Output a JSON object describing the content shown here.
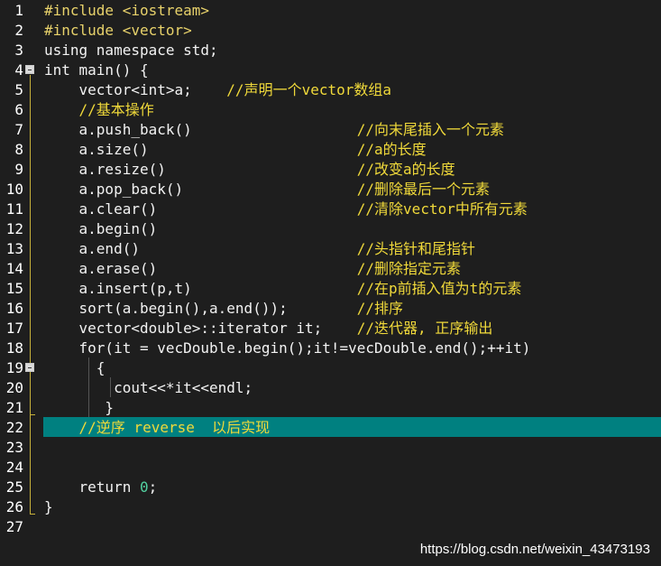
{
  "editor": {
    "line_numbers": [
      "1",
      "2",
      "3",
      "4",
      "5",
      "6",
      "7",
      "8",
      "9",
      "10",
      "11",
      "12",
      "13",
      "14",
      "15",
      "16",
      "17",
      "18",
      "19",
      "20",
      "21",
      "22",
      "23",
      "24",
      "25",
      "26",
      "27"
    ],
    "highlighted_line": "22",
    "lines": [
      {
        "n": "1",
        "segments": [
          {
            "cls": "t-pre",
            "text": "#include <iostream>"
          }
        ]
      },
      {
        "n": "2",
        "segments": [
          {
            "cls": "t-pre",
            "text": "#include <vector>"
          }
        ]
      },
      {
        "n": "3",
        "segments": [
          {
            "cls": "t-plain",
            "text": "using namespace std;"
          }
        ]
      },
      {
        "n": "4",
        "segments": [
          {
            "cls": "t-plain",
            "text": "int main() {"
          }
        ]
      },
      {
        "n": "5",
        "segments": [
          {
            "cls": "t-plain",
            "text": "    vector<int>a;    "
          },
          {
            "cls": "t-com",
            "text": "//声明一个vector数组a"
          }
        ]
      },
      {
        "n": "6",
        "segments": [
          {
            "cls": "t-com",
            "text": "    //基本操作"
          }
        ]
      },
      {
        "n": "7",
        "segments": [
          {
            "cls": "t-plain",
            "text": "    a.push_back()                   "
          },
          {
            "cls": "t-com",
            "text": "//向末尾插入一个元素"
          }
        ]
      },
      {
        "n": "8",
        "segments": [
          {
            "cls": "t-plain",
            "text": "    a.size()                        "
          },
          {
            "cls": "t-com",
            "text": "//a的长度"
          }
        ]
      },
      {
        "n": "9",
        "segments": [
          {
            "cls": "t-plain",
            "text": "    a.resize()                      "
          },
          {
            "cls": "t-com",
            "text": "//改变a的长度"
          }
        ]
      },
      {
        "n": "10",
        "segments": [
          {
            "cls": "t-plain",
            "text": "    a.pop_back()                    "
          },
          {
            "cls": "t-com",
            "text": "//删除最后一个元素"
          }
        ]
      },
      {
        "n": "11",
        "segments": [
          {
            "cls": "t-plain",
            "text": "    a.clear()                       "
          },
          {
            "cls": "t-com",
            "text": "//清除vector中所有元素"
          }
        ]
      },
      {
        "n": "12",
        "segments": [
          {
            "cls": "t-plain",
            "text": "    a.begin()"
          }
        ]
      },
      {
        "n": "13",
        "segments": [
          {
            "cls": "t-plain",
            "text": "    a.end()                         "
          },
          {
            "cls": "t-com",
            "text": "//头指针和尾指针"
          }
        ]
      },
      {
        "n": "14",
        "segments": [
          {
            "cls": "t-plain",
            "text": "    a.erase()                       "
          },
          {
            "cls": "t-com",
            "text": "//删除指定元素"
          }
        ]
      },
      {
        "n": "15",
        "segments": [
          {
            "cls": "t-plain",
            "text": "    a.insert(p,t)                   "
          },
          {
            "cls": "t-com",
            "text": "//在p前插入值为t的元素"
          }
        ]
      },
      {
        "n": "16",
        "segments": [
          {
            "cls": "t-plain",
            "text": "    sort(a.begin(),a.end());        "
          },
          {
            "cls": "t-com",
            "text": "//排序"
          }
        ]
      },
      {
        "n": "17",
        "segments": [
          {
            "cls": "t-plain",
            "text": "    vector<double>::iterator it;    "
          },
          {
            "cls": "t-com",
            "text": "//迭代器, 正序输出"
          }
        ]
      },
      {
        "n": "18",
        "segments": [
          {
            "cls": "t-plain",
            "text": "    for(it = vecDouble.begin();it!=vecDouble.end();++it)"
          }
        ]
      },
      {
        "n": "19",
        "segments": [
          {
            "cls": "t-plain",
            "text": "      {"
          }
        ]
      },
      {
        "n": "20",
        "segments": [
          {
            "cls": "t-plain",
            "text": "        cout<<*it<<endl;"
          }
        ]
      },
      {
        "n": "21",
        "segments": [
          {
            "cls": "t-plain",
            "text": "       }"
          }
        ]
      },
      {
        "n": "22",
        "segments": [
          {
            "cls": "t-com",
            "text": "    //逆序 reverse  以后实现"
          }
        ]
      },
      {
        "n": "23",
        "segments": []
      },
      {
        "n": "24",
        "segments": []
      },
      {
        "n": "25",
        "segments": [
          {
            "cls": "t-plain",
            "text": "    return "
          },
          {
            "cls": "t-num",
            "text": "0"
          },
          {
            "cls": "t-plain",
            "text": ";"
          }
        ]
      },
      {
        "n": "26",
        "segments": [
          {
            "cls": "t-plain",
            "text": "}"
          }
        ]
      },
      {
        "n": "27",
        "segments": []
      }
    ]
  },
  "watermark": "https://blog.csdn.net/weixin_43473193"
}
